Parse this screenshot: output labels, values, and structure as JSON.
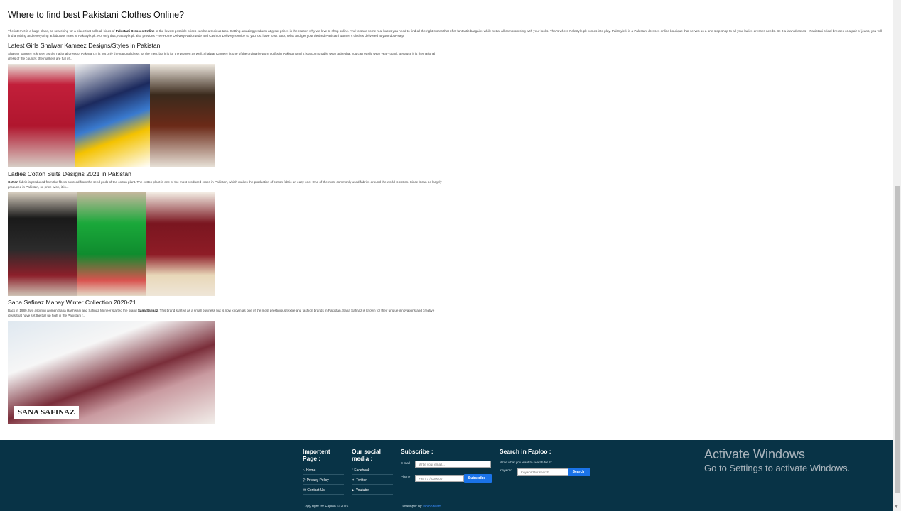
{
  "page": {
    "title": "Where to find best Pakistani Clothes Online?",
    "intro_a": "The internet is a huge place, so searching for a place that sells all kinds of ",
    "intro_bold": "Pakistani Dresses Online",
    "intro_b": " at the lowest possible prices can be a tedious task. Getting amazing products at great prices is the reason why we love to shop online. And to save some real bucks you need to find all the right stores that offer fantastic bargains while not at all compromising with your looks. That's where PakStyle.pk comes into play. PakStyle.k is a Pakistani dresses online boutique that serves as a one-stop shop to all your ladies dresses needs. Be it a lawn dresses, ~Pakistani bridal dresses or a pair of jeans, you will find anything and everything at fabulous rates at PakStyle.pk. Not only that, PakStyle.pk also provides Free Home Delivery Nationwide and Cash on Delivery service so you just have to sit back, relax and get your desired Pakistani women's clothes delivered at your door-step."
  },
  "articles": [
    {
      "title": "Latest Girls Shalwar Kameez Designs/Styles in Pakistan",
      "bold": "",
      "text": "Shalwar kameez is known as the national dress of Pakistan. It is not only the national dress for the men, but it is for the women as well. Shalwar Kameez is one of the ordinarily worn outfits in Pakistan and it is a comfortable wear attire that you can easily wear year-round. Because it is the national dress of the country, the markets are full of..."
    },
    {
      "title": "Ladies Cotton Suits Designs 2021 in Pakistan",
      "bold": "Cotton",
      "text": " fabric is produced from the fibers sourced from the seed pods of the cotton plant. The cotton plant is one of the most produced crops in Pakistan, which makes the production of cotton fabric an easy one. One of the most commonly used fabrics around the world is cotton. Since it can be largely produced in Pakistan, so price-wise, it is..."
    },
    {
      "title": "Sana Safinaz Mahay Winter Collection 2020-21",
      "text_a": "Back in 1989, two aspiring women Sana Hashwani and Safinaz Muneer started the brand ",
      "bold": "Sana Safinaz",
      "text": ". This brand started as a small business but is now known as one of the most prestigious textile and fashion brands in Pakistan. Sana Safinaz is known for their unique innovations and creative ideas that have set the bar up high in the Pakistani f...",
      "image_label": "SANA SAFINAZ"
    }
  ],
  "footer": {
    "col1": {
      "title_l1": "Importent",
      "title_l2": "Page :",
      "links": [
        "Home",
        "Privacy Policy",
        "Contact Us"
      ],
      "icons": [
        "home-icon",
        "link-icon",
        "envelope-icon"
      ]
    },
    "col2": {
      "title_l1": "Our social",
      "title_l2": "media :",
      "links": [
        "Facebook",
        "Twitter",
        "Youtube"
      ],
      "icons": [
        "facebook-icon",
        "twitter-icon",
        "youtube-icon"
      ]
    },
    "subscribe": {
      "title": "Subscribe :",
      "email_label": "E-mail",
      "email_placeholder": "Write your email...",
      "phone_label": "Phone",
      "phone_placeholder": "+98 / 7 / 000000",
      "button": "Subscribe !"
    },
    "search": {
      "title": "Search in Faploo :",
      "hint": "Write what you want to search for it :",
      "keyword_label": "Keyword",
      "placeholder": "Keyword for search...",
      "button": "Search !"
    },
    "copyright": "Copy right for Faploo © 2015",
    "developer_label": "Developer by ",
    "developer_link": "faploo team..."
  },
  "overlay": {
    "line1": "Activate Windows",
    "line2": "Go to Settings to activate Windows."
  },
  "colors": {
    "footer_bg": "#083346",
    "button_blue": "#1a73e8"
  }
}
